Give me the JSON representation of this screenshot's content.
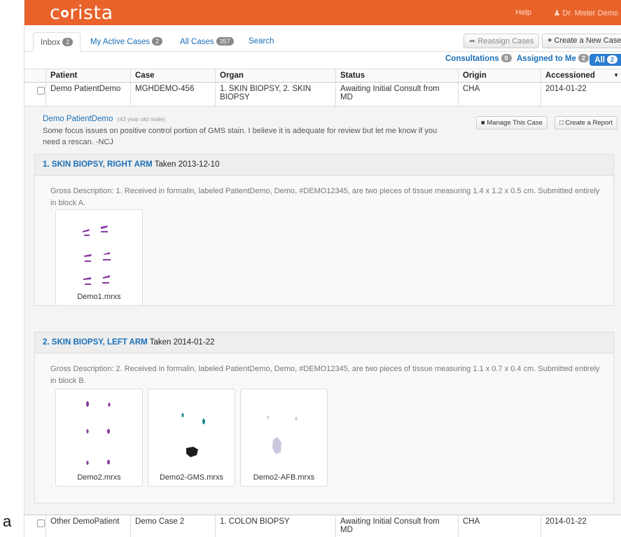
{
  "figure_label": "a",
  "app": {
    "logo": "crista",
    "help": "Help",
    "user": "Dr. Mister Demo"
  },
  "tabs": [
    {
      "label": "Inbox",
      "count": "2"
    },
    {
      "label": "My Active Cases",
      "count": "2"
    },
    {
      "label": "All Cases",
      "count": "357"
    },
    {
      "label": "Search",
      "count": ""
    }
  ],
  "toolbar": {
    "reassign": "Reassign Cases",
    "create": "Create a New Case"
  },
  "filters": {
    "consultations": "Consultations",
    "consultations_count": "0",
    "assigned": "Assigned to Me",
    "assigned_count": "2",
    "all": "All",
    "all_count": "2"
  },
  "table": {
    "columns": [
      "Patient",
      "Case",
      "Organ",
      "Status",
      "Origin",
      "Accessioned"
    ],
    "rows": [
      [
        "Demo PatientDemo",
        "MGHDEMO-456",
        "1. SKIN BIOPSY, 2. SKIN BIOPSY",
        "Awaiting Initial Consult from MD",
        "CHA",
        "2014-01-22"
      ],
      [
        "Other DemoPatient",
        "Demo Case 2",
        "1. COLON BIOPSY",
        "Awaiting Initial Consult from MD",
        "CHA",
        "2014-01-22"
      ]
    ]
  },
  "detail": {
    "patient": "Demo PatientDemo",
    "patient_info": "(43 year old male)",
    "note": "Some focus issues on positive control portion of GMS stain. I believe it is adequate for review but let me know if you need a rescan. -NCJ",
    "manage": "Manage This Case",
    "report": "Create a Report",
    "parts": [
      {
        "title": "1. SKIN BIOPSY, RIGHT ARM",
        "taken": "Taken 2013-12-10",
        "gross": "Gross Description: 1. Received in formalin, labeled PatientDemo, Demo, #DEMO12345, are two pieces of tissue measuring 1.4 x 1.2 x 0.5 cm. Submitted entirely in block A.",
        "slides": [
          "Demo1.mrxs"
        ]
      },
      {
        "title": "2. SKIN BIOPSY, LEFT ARM",
        "taken": "Taken 2014-01-22",
        "gross": "Gross Description: 2. Received in formalin, labeled PatientDemo, Demo, #DEMO12345, are two pieces of tissue measuring 1.1 x 0.7 x 0.4 cm. Submitted entirely in block B.",
        "slides": [
          "Demo2.mrxs",
          "Demo2-GMS.mrxs",
          "Demo2-AFB.mrxs"
        ]
      }
    ]
  },
  "colors": {
    "brand": "#e8622a",
    "link": "#1a6fb7",
    "all_pill": "#2a7dd0"
  }
}
